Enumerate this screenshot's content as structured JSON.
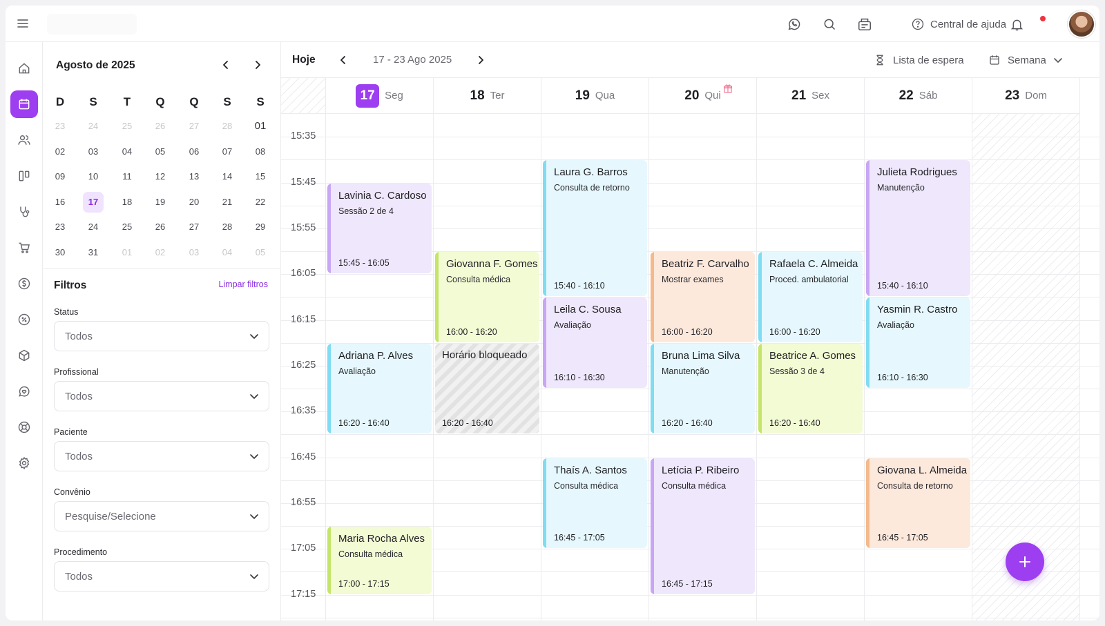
{
  "topbar": {
    "help_label": "Central de ajuda",
    "icons": [
      "menu-icon",
      "whatsapp-icon",
      "search-icon",
      "agenda-icon",
      "help-icon",
      "bell-icon"
    ]
  },
  "rail": {
    "items": [
      "home-icon",
      "calendar-icon",
      "users-icon",
      "kanban-icon",
      "stethoscope-icon",
      "cart-icon",
      "dollar-icon",
      "percent-icon",
      "box-icon",
      "heart-chat-icon",
      "support-icon",
      "settings-icon"
    ],
    "active_index": 1
  },
  "mini_calendar": {
    "title": "Agosto de 2025",
    "weekdays": [
      "D",
      "S",
      "T",
      "Q",
      "Q",
      "S",
      "S"
    ],
    "weeks": [
      [
        "23",
        "24",
        "25",
        "26",
        "27",
        "28",
        "01"
      ],
      [
        "02",
        "03",
        "04",
        "05",
        "06",
        "07",
        "08"
      ],
      [
        "09",
        "10",
        "11",
        "12",
        "13",
        "14",
        "15"
      ],
      [
        "16",
        "17",
        "18",
        "19",
        "20",
        "21",
        "22"
      ],
      [
        "23",
        "24",
        "25",
        "26",
        "27",
        "28",
        "29"
      ],
      [
        "30",
        "31",
        "01",
        "02",
        "03",
        "04",
        "05"
      ]
    ],
    "selected_day": "17"
  },
  "filters": {
    "title": "Filtros",
    "clear_label": "Limpar filtros",
    "fields": [
      {
        "label": "Status",
        "value": "Todos"
      },
      {
        "label": "Profissional",
        "value": "Todos"
      },
      {
        "label": "Paciente",
        "value": "Todos"
      },
      {
        "label": "Convênio",
        "value": "Pesquise/Selecione"
      },
      {
        "label": "Procedimento",
        "value": "Todos"
      }
    ]
  },
  "toolbar": {
    "today_label": "Hoje",
    "range_label": "17 - 23 Ago 2025",
    "waitlist_label": "Lista de espera",
    "view_label": "Semana"
  },
  "days": [
    {
      "num": "17",
      "dow": "Seg",
      "today": true
    },
    {
      "num": "18",
      "dow": "Ter"
    },
    {
      "num": "19",
      "dow": "Qua"
    },
    {
      "num": "20",
      "dow": "Qui",
      "birthday": true
    },
    {
      "num": "21",
      "dow": "Sex"
    },
    {
      "num": "22",
      "dow": "Sáb"
    },
    {
      "num": "23",
      "dow": "Dom",
      "closed": true
    }
  ],
  "time_labels": [
    "15:35",
    "15:45",
    "15:55",
    "16:05",
    "16:15",
    "16:25",
    "16:35",
    "16:45",
    "16:55",
    "17:05",
    "17:15"
  ],
  "colors": {
    "accent": "#9d3ef0",
    "lavender_bg": "#efe7fc",
    "lavender_bar": "#c8a6f5",
    "cyan_bg": "#e6f8fd",
    "cyan_bar": "#80dcf2",
    "lime_bg": "#f2fbd4",
    "lime_bar": "#c4e56a",
    "peach_bg": "#fde9dc",
    "peach_bar": "#f5b98b"
  },
  "events": [
    {
      "day": 0,
      "name": "Lavinia C. Cardoso",
      "proc": "Sessão 2 de 4",
      "time": "15:45 - 16:05",
      "start": "15:45",
      "end": "16:05",
      "color": "lavender"
    },
    {
      "day": 0,
      "name": "Adriana P. Alves",
      "proc": "Avaliação",
      "time": "16:20 - 16:40",
      "start": "16:20",
      "end": "16:40",
      "color": "cyan"
    },
    {
      "day": 0,
      "name": "Maria Rocha Alves",
      "proc": "Consulta médica",
      "time": "17:00 - 17:15",
      "start": "17:00",
      "end": "17:15",
      "color": "lime"
    },
    {
      "day": 1,
      "name": "Giovanna F. Gomes",
      "proc": "Consulta médica",
      "time": "16:00 - 16:20",
      "start": "16:00",
      "end": "16:20",
      "color": "lime"
    },
    {
      "day": 1,
      "name": "Horário bloqueado",
      "proc": "",
      "time": "16:20 - 16:40",
      "start": "16:20",
      "end": "16:40",
      "color": "blocked"
    },
    {
      "day": 2,
      "name": "Laura G. Barros",
      "proc": "Consulta de retorno",
      "time": "15:40 - 16:10",
      "start": "15:40",
      "end": "16:10",
      "color": "cyan"
    },
    {
      "day": 2,
      "name": "Leila C. Sousa",
      "proc": "Avaliação",
      "time": "16:10 - 16:30",
      "start": "16:10",
      "end": "16:30",
      "color": "lavender"
    },
    {
      "day": 2,
      "name": "Thaís A. Santos",
      "proc": "Consulta médica",
      "time": "16:45 - 17:05",
      "start": "16:45",
      "end": "17:05",
      "color": "cyan"
    },
    {
      "day": 3,
      "name": "Beatriz F. Carvalho",
      "proc": "Mostrar exames",
      "time": "16:00 - 16:20",
      "start": "16:00",
      "end": "16:20",
      "color": "peach"
    },
    {
      "day": 3,
      "name": "Bruna Lima Silva",
      "proc": "Manutenção",
      "time": "16:20 - 16:40",
      "start": "16:20",
      "end": "16:40",
      "color": "cyan"
    },
    {
      "day": 3,
      "name": "Letícia P. Ribeiro",
      "proc": "Consulta médica",
      "time": "16:45 - 17:15",
      "start": "16:45",
      "end": "17:15",
      "color": "lavender"
    },
    {
      "day": 4,
      "name": "Rafaela C. Almeida",
      "proc": "Proced. ambulatorial",
      "time": "16:00 - 16:20",
      "start": "16:00",
      "end": "16:20",
      "color": "cyan"
    },
    {
      "day": 4,
      "name": "Beatrice A. Gomes",
      "proc": "Sessão 3 de 4",
      "time": "16:20 - 16:40",
      "start": "16:20",
      "end": "16:40",
      "color": "lime"
    },
    {
      "day": 5,
      "name": "Julieta Rodrigues",
      "proc": "Manutenção",
      "time": "15:40 - 16:10",
      "start": "15:40",
      "end": "16:10",
      "color": "lavender"
    },
    {
      "day": 5,
      "name": "Yasmin R. Castro",
      "proc": "Avaliação",
      "time": "16:10 - 16:30",
      "start": "16:10",
      "end": "16:30",
      "color": "cyan"
    },
    {
      "day": 5,
      "name": "Giovana L. Almeida",
      "proc": "Consulta de retorno",
      "time": "16:45 - 17:05",
      "start": "16:45",
      "end": "17:05",
      "color": "peach"
    }
  ]
}
